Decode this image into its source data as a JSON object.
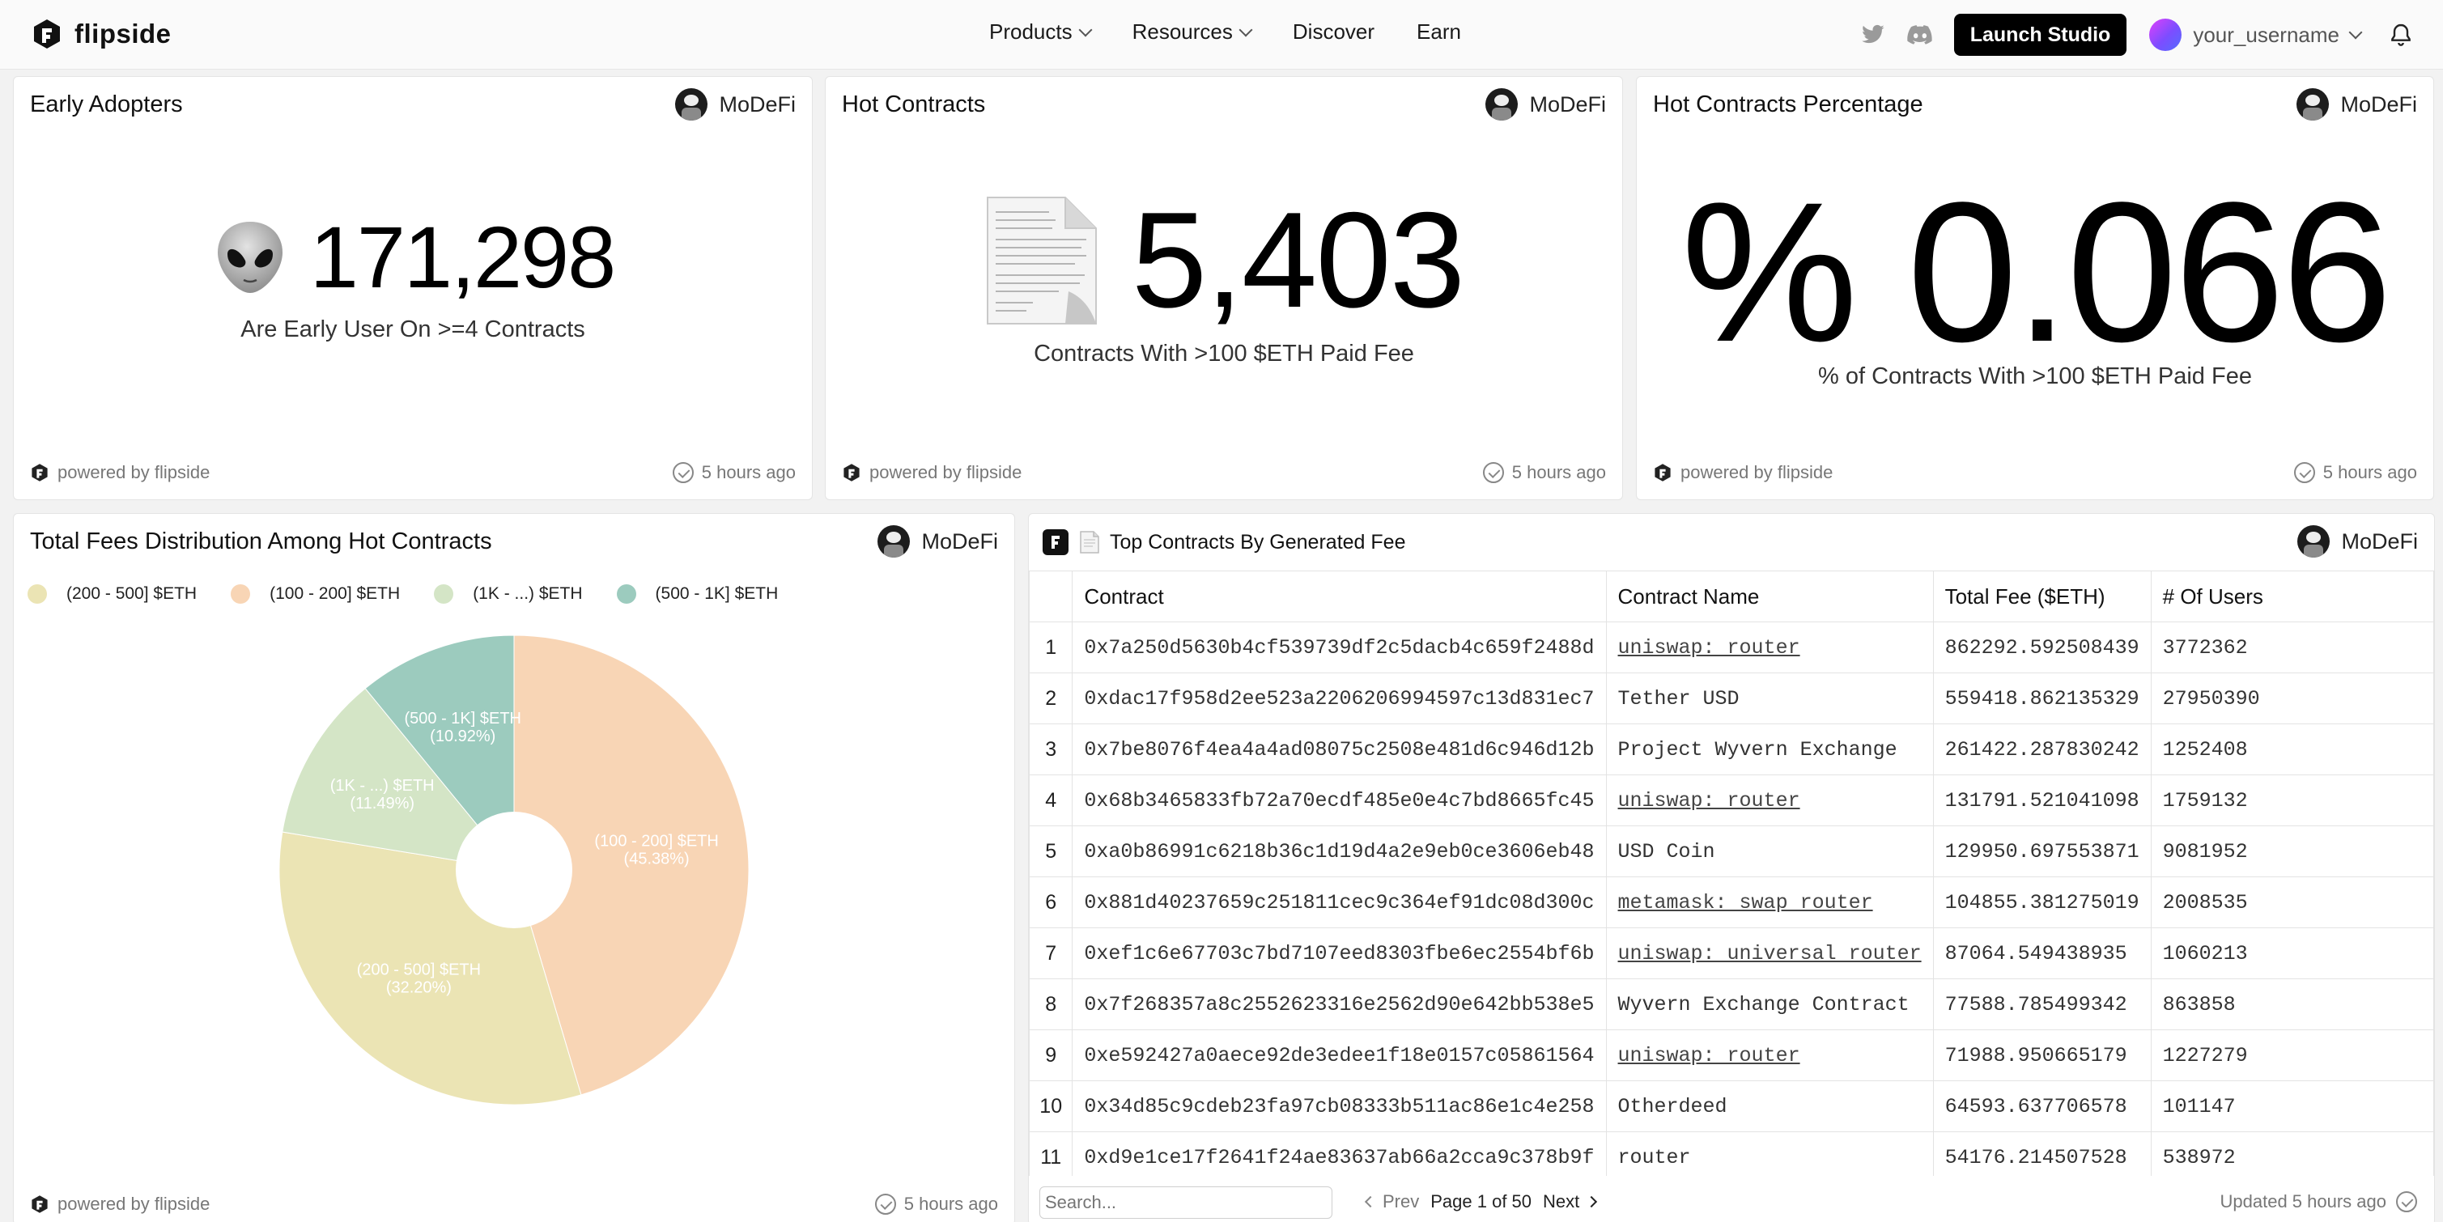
{
  "nav": {
    "brand": "flipside",
    "links": [
      {
        "label": "Products",
        "has_menu": true
      },
      {
        "label": "Resources",
        "has_menu": true
      },
      {
        "label": "Discover",
        "has_menu": false
      },
      {
        "label": "Earn",
        "has_menu": false
      }
    ],
    "launch_label": "Launch Studio",
    "username": "your_username"
  },
  "common": {
    "owner": "MoDeFi",
    "powered_by": "powered by flipside",
    "time_ago": "5 hours ago"
  },
  "early_adopters": {
    "title": "Early Adopters",
    "value": "171,298",
    "subtitle": "Are Early User On >=4 Contracts"
  },
  "hot_contracts": {
    "title": "Hot Contracts",
    "value": "5,403",
    "subtitle": "Contracts With >100 $ETH Paid Fee"
  },
  "hot_pct": {
    "title": "Hot Contracts Percentage",
    "value": "% 0.066",
    "subtitle": "% of Contracts With >100 $ETH Paid Fee"
  },
  "fees_dist": {
    "title": "Total Fees Distribution Among Hot Contracts"
  },
  "chart_data": {
    "type": "pie",
    "donut": true,
    "legend_position": "top-left",
    "legend_order": [
      "(200 - 500] $ETH",
      "(100 - 200] $ETH",
      "(1K - ...) $ETH",
      "(500 - 1K] $ETH"
    ],
    "slices": [
      {
        "label": "(100 - 200] $ETH",
        "value": 45.38,
        "pct_label": "(45.38%)",
        "color": "#f8d5b5"
      },
      {
        "label": "(200 - 500] $ETH",
        "value": 32.2,
        "pct_label": "(32.20%)",
        "color": "#ebe4b4"
      },
      {
        "label": "(1K - ...) $ETH",
        "value": 11.49,
        "pct_label": "(11.49%)",
        "color": "#d4e5c6"
      },
      {
        "label": "(500 - 1K] $ETH",
        "value": 10.92,
        "pct_label": "(10.92%)",
        "color": "#9ccbbe"
      }
    ]
  },
  "top_contracts": {
    "title": "Top Contracts By Generated Fee",
    "columns": [
      "",
      "Contract",
      "Contract Name",
      "Total Fee ($ETH)",
      "# Of Users"
    ],
    "rows": [
      {
        "idx": "1",
        "contract": "0x7a250d5630b4cf539739df2c5dacb4c659f2488d",
        "name": "uniswap: router",
        "is_link": true,
        "fee": "862292.592508439",
        "users": "3772362"
      },
      {
        "idx": "2",
        "contract": "0xdac17f958d2ee523a2206206994597c13d831ec7",
        "name": "Tether USD",
        "is_link": false,
        "fee": "559418.862135329",
        "users": "27950390"
      },
      {
        "idx": "3",
        "contract": "0x7be8076f4ea4a4ad08075c2508e481d6c946d12b",
        "name": "Project Wyvern Exchange",
        "is_link": false,
        "fee": "261422.287830242",
        "users": "1252408"
      },
      {
        "idx": "4",
        "contract": "0x68b3465833fb72a70ecdf485e0e4c7bd8665fc45",
        "name": "uniswap: router",
        "is_link": true,
        "fee": "131791.521041098",
        "users": "1759132"
      },
      {
        "idx": "5",
        "contract": "0xa0b86991c6218b36c1d19d4a2e9eb0ce3606eb48",
        "name": "USD Coin",
        "is_link": false,
        "fee": "129950.697553871",
        "users": "9081952"
      },
      {
        "idx": "6",
        "contract": "0x881d40237659c251811cec9c364ef91dc08d300c",
        "name": "metamask: swap router",
        "is_link": true,
        "fee": "104855.381275019",
        "users": "2008535"
      },
      {
        "idx": "7",
        "contract": "0xef1c6e67703c7bd7107eed8303fbe6ec2554bf6b",
        "name": "uniswap: universal router",
        "is_link": true,
        "fee": "87064.549438935",
        "users": "1060213"
      },
      {
        "idx": "8",
        "contract": "0x7f268357a8c2552623316e2562d90e642bb538e5",
        "name": "Wyvern Exchange Contract",
        "is_link": false,
        "fee": "77588.785499342",
        "users": "863858"
      },
      {
        "idx": "9",
        "contract": "0xe592427a0aece92de3edee1f18e0157c05861564",
        "name": "uniswap: router",
        "is_link": true,
        "fee": "71988.950665179",
        "users": "1227279"
      },
      {
        "idx": "10",
        "contract": "0x34d85c9cdeb23fa97cb08333b511ac86e1c4e258",
        "name": "Otherdeed",
        "is_link": false,
        "fee": "64593.637706578",
        "users": "101147"
      },
      {
        "idx": "11",
        "contract": "0xd9e1ce17f2641f24ae83637ab66a2cca9c378b9f",
        "name": "router",
        "is_link": false,
        "fee": "54176.214507528",
        "users": "538972"
      }
    ],
    "search_placeholder": "Search...",
    "prev_label": "Prev",
    "page_label": "Page 1 of 50",
    "next_label": "Next",
    "updated_label": "Updated 5 hours ago"
  }
}
